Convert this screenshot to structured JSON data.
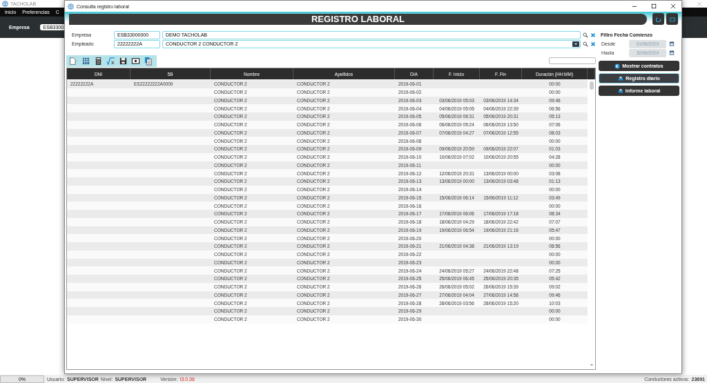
{
  "app": {
    "title": "TACHOLAB",
    "menu": [
      "Inicio",
      "Preferencias",
      "C"
    ],
    "company_label": "Empresa",
    "company_value": "ESB3300"
  },
  "dialog": {
    "title": "Consulta registro laboral",
    "header": "REGISTRO LABORAL",
    "form": [
      {
        "label": "Empresa",
        "code": "ESB33000000",
        "name": "DEMO TACHOLAB",
        "dropdown": false
      },
      {
        "label": "Empleado",
        "code": "22222222A",
        "name": "CONDUCTOR 2 CONDUCTOR 2",
        "dropdown": true
      }
    ],
    "filter": {
      "title": "Filtro Fecha Comienzo",
      "fields": [
        {
          "label": "Desde",
          "value": "01/06/2019",
          "disabled": true
        },
        {
          "label": "Hasta",
          "value": "30/06/2019",
          "disabled": true
        }
      ]
    },
    "actions": [
      {
        "label": "Mostrar contratos",
        "kind": "euro",
        "selected": false
      },
      {
        "label": "Registro diario",
        "kind": "printer",
        "selected": true
      },
      {
        "label": "Informe laboral",
        "kind": "printer",
        "selected": false
      }
    ],
    "table": {
      "columns": [
        "DNI",
        "5B",
        "Nombre",
        "Apellidos",
        "DIA",
        "F. Inicio",
        "F. Fin",
        "Duración (HH:MM)"
      ],
      "rows": [
        [
          "22222222A",
          "ES22222222A0000",
          "CONDUCTOR 2",
          "CONDUCTOR 2",
          "2019-06-01",
          "",
          "",
          "00:00"
        ],
        [
          "",
          "",
          "CONDUCTOR 2",
          "CONDUCTOR 2",
          "2019-06-02",
          "",
          "",
          "00:00"
        ],
        [
          "",
          "",
          "CONDUCTOR 2",
          "CONDUCTOR 2",
          "2019-06-03",
          "03/06/2019 05:03",
          "03/06/2019 14:34",
          "09:46"
        ],
        [
          "",
          "",
          "CONDUCTOR 2",
          "CONDUCTOR 2",
          "2019-06-04",
          "04/06/2019 05:05",
          "04/06/2019 22:39",
          "06:56"
        ],
        [
          "",
          "",
          "CONDUCTOR 2",
          "CONDUCTOR 2",
          "2019-06-05",
          "05/06/2019 06:31",
          "05/06/2019 20:31",
          "05:13"
        ],
        [
          "",
          "",
          "CONDUCTOR 2",
          "CONDUCTOR 2",
          "2019-06-06",
          "06/06/2019 05:24",
          "06/06/2019 13:50",
          "07:06"
        ],
        [
          "",
          "",
          "CONDUCTOR 2",
          "CONDUCTOR 2",
          "2019-06-07",
          "07/06/2019 04:27",
          "07/06/2019 12:55",
          "08:03"
        ],
        [
          "",
          "",
          "CONDUCTOR 2",
          "CONDUCTOR 2",
          "2019-06-08",
          "",
          "",
          "00:00"
        ],
        [
          "",
          "",
          "CONDUCTOR 2",
          "CONDUCTOR 2",
          "2019-06-09",
          "09/06/2019 20:59",
          "09/06/2019 22:07",
          "01:03"
        ],
        [
          "",
          "",
          "CONDUCTOR 2",
          "CONDUCTOR 2",
          "2019-06-10",
          "10/06/2019 07:02",
          "10/06/2019 20:55",
          "04:28"
        ],
        [
          "",
          "",
          "CONDUCTOR 2",
          "CONDUCTOR 2",
          "2019-06-11",
          "",
          "",
          "00:00"
        ],
        [
          "",
          "",
          "CONDUCTOR 2",
          "CONDUCTOR 2",
          "2019-06-12",
          "12/06/2019 20:31",
          "13/06/2019 00:00",
          "03:08"
        ],
        [
          "",
          "",
          "CONDUCTOR 2",
          "CONDUCTOR 2",
          "2019-06-13",
          "13/06/2019 00:00",
          "13/06/2019 03:48",
          "01:13"
        ],
        [
          "",
          "",
          "CONDUCTOR 2",
          "CONDUCTOR 2",
          "2019-06-14",
          "",
          "",
          "00:00"
        ],
        [
          "",
          "",
          "CONDUCTOR 2",
          "CONDUCTOR 2",
          "2019-06-15",
          "15/06/2019 06:14",
          "15/06/2019 11:12",
          "03:49"
        ],
        [
          "",
          "",
          "CONDUCTOR 2",
          "CONDUCTOR 2",
          "2019-06-16",
          "",
          "",
          "00:00"
        ],
        [
          "",
          "",
          "CONDUCTOR 2",
          "CONDUCTOR 2",
          "2019-06-17",
          "17/06/2019 06:06",
          "17/06/2019 17:18",
          "08:34"
        ],
        [
          "",
          "",
          "CONDUCTOR 2",
          "CONDUCTOR 2",
          "2019-06-18",
          "18/06/2019 04:29",
          "18/06/2019 22:42",
          "07:07"
        ],
        [
          "",
          "",
          "CONDUCTOR 2",
          "CONDUCTOR 2",
          "2019-06-19",
          "19/06/2019 06:54",
          "19/06/2019 21:16",
          "05:47"
        ],
        [
          "",
          "",
          "CONDUCTOR 2",
          "CONDUCTOR 2",
          "2019-06-20",
          "",
          "",
          "00:00"
        ],
        [
          "",
          "",
          "CONDUCTOR 2",
          "CONDUCTOR 2",
          "2019-06-21",
          "21/06/2019 04:38",
          "21/06/2019 13:19",
          "08:56"
        ],
        [
          "",
          "",
          "CONDUCTOR 2",
          "CONDUCTOR 2",
          "2019-06-22",
          "",
          "",
          "00:00"
        ],
        [
          "",
          "",
          "CONDUCTOR 2",
          "CONDUCTOR 2",
          "2019-06-23",
          "",
          "",
          "00:00"
        ],
        [
          "",
          "",
          "CONDUCTOR 2",
          "CONDUCTOR 2",
          "2019-06-24",
          "24/06/2019 05:27",
          "24/06/2019 22:48",
          "07:25"
        ],
        [
          "",
          "",
          "CONDUCTOR 2",
          "CONDUCTOR 2",
          "2019-06-25",
          "25/06/2019 06:45",
          "25/06/2019 20:35",
          "05:42"
        ],
        [
          "",
          "",
          "CONDUCTOR 2",
          "CONDUCTOR 2",
          "2019-06-26",
          "26/06/2019 05:02",
          "26/06/2019 15:39",
          "09:02"
        ],
        [
          "",
          "",
          "CONDUCTOR 2",
          "CONDUCTOR 2",
          "2019-06-27",
          "27/06/2019 04:04",
          "27/06/2019 14:58",
          "09:46"
        ],
        [
          "",
          "",
          "CONDUCTOR 2",
          "CONDUCTOR 2",
          "2019-06-28",
          "28/06/2019 03:56",
          "28/06/2019 15:20",
          "10:03"
        ],
        [
          "",
          "",
          "CONDUCTOR 2",
          "CONDUCTOR 2",
          "2019-06-29",
          "",
          "",
          "00:00"
        ],
        [
          "",
          "",
          "CONDUCTOR 2",
          "CONDUCTOR 2",
          "2019-06-30",
          "",
          "",
          "00:00"
        ]
      ]
    }
  },
  "status_bar": {
    "progress": {
      "level": 0,
      "text": "0%"
    },
    "user_label": "Usuario:",
    "user": "SUPERVISOR",
    "level_label": "Nivel:",
    "level_value": "SUPERVISOR",
    "version_label": "Versión:",
    "version": "t3.0.36",
    "active_label": "Conductores activos:",
    "active_count": "23691"
  }
}
